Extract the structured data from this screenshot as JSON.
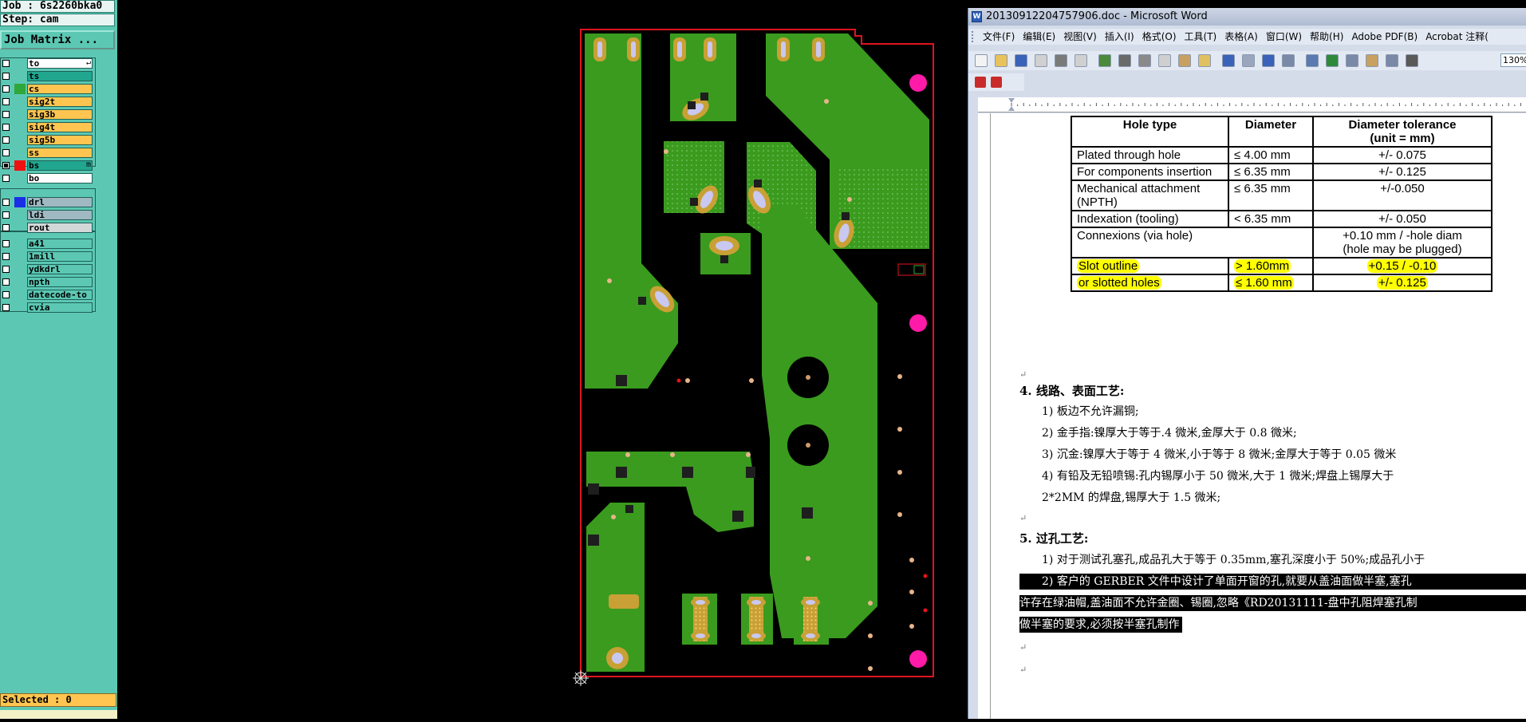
{
  "cam": {
    "job_label": "Job : 6s2260bka0",
    "step_label": "Step: cam",
    "job_matrix_button": "Job Matrix ...",
    "selected_label": "Selected : 0",
    "layers": [
      {
        "name": "to",
        "color": "#ffffff",
        "swatch": "",
        "checked": false,
        "mark": "↵"
      },
      {
        "name": "ts",
        "color": "#21a68f",
        "swatch": "",
        "checked": false
      },
      {
        "name": "cs",
        "color": "#ffc550",
        "swatch": "#2ea83a",
        "checked": false
      },
      {
        "name": "sig2t",
        "color": "#ffc550",
        "swatch": "",
        "checked": false
      },
      {
        "name": "sig3b",
        "color": "#ffc550",
        "swatch": "",
        "checked": false
      },
      {
        "name": "sig4t",
        "color": "#ffc550",
        "swatch": "",
        "checked": false
      },
      {
        "name": "sig5b",
        "color": "#ffc550",
        "swatch": "",
        "checked": false
      },
      {
        "name": "ss",
        "color": "#ffc550",
        "swatch": "",
        "checked": false
      },
      {
        "name": "bs",
        "color": "#21a68f",
        "swatch": "#ee1111",
        "checked": true,
        "mark": "m"
      },
      {
        "name": "bo",
        "color": "#ffffff",
        "swatch": "",
        "checked": false
      },
      {
        "name": "drl",
        "color": "#9fb8c2",
        "swatch": "#1a2ee8",
        "checked": false
      },
      {
        "name": "ldi",
        "color": "#9fb8c2",
        "swatch": "",
        "checked": false
      },
      {
        "name": "rout",
        "color": "#d2d8d8",
        "swatch": "",
        "checked": false
      },
      {
        "name": "a41",
        "color": "#5cc8b4",
        "swatch": "",
        "checked": false
      },
      {
        "name": "1mill",
        "color": "#5cc8b4",
        "swatch": "",
        "checked": false
      },
      {
        "name": "ydkdrl",
        "color": "#5cc8b4",
        "swatch": "",
        "checked": false
      },
      {
        "name": "npth",
        "color": "#5cc8b4",
        "swatch": "",
        "checked": false
      },
      {
        "name": "datecode-to",
        "color": "#5cc8b4",
        "swatch": "",
        "checked": false
      },
      {
        "name": "cvia",
        "color": "#5cc8b4",
        "swatch": "",
        "checked": false
      }
    ]
  },
  "pcb": {
    "colors": {
      "copper": "#3a9b1e",
      "outline": "#e0141e",
      "pad": "#c9a035",
      "hole": "#c9c8f0",
      "fiducial": "#ff1aa8",
      "background": "#000000"
    }
  },
  "word": {
    "title": "20130912204757906.doc - Microsoft Word",
    "menu": [
      "文件(F)",
      "编辑(E)",
      "视图(V)",
      "插入(I)",
      "格式(O)",
      "工具(T)",
      "表格(A)",
      "窗口(W)",
      "帮助(H)",
      "Adobe PDF(B)",
      "Acrobat 注释("
    ],
    "zoom": "130%",
    "table": {
      "headers": [
        "Hole type",
        "Diameter",
        "Diameter tolerance\n(unit = mm)"
      ],
      "rows": [
        [
          "Plated through hole",
          "≤ 4.00 mm",
          "+/- 0.075"
        ],
        [
          "For components insertion",
          "≤ 6.35 mm",
          "+/- 0.125"
        ],
        [
          "Mechanical attachment (NPTH)",
          "≤ 6.35 mm",
          "+/-0.050"
        ],
        [
          "Indexation (tooling)",
          "< 6.35 mm",
          "+/- 0.050"
        ],
        [
          "Connexions (via hole)",
          "",
          "+0.10 mm / -hole diam\n(hole may be plugged)"
        ],
        [
          "Slot outline",
          "> 1.60mm",
          "+0.15 / -0.10"
        ],
        [
          "or slotted holes",
          "≤ 1.60 mm",
          "+/- 0.125"
        ]
      ]
    },
    "section4": {
      "heading": "4.   线路、表面工艺:",
      "items": [
        "1)  板边不允许漏铜;",
        "2)  金手指:镍厚大于等于.4 微米,金厚大于 0.8 微米;",
        "3)  沉金:镍厚大于等于 4 微米,小于等于 8 微米;金厚大于等于 0.05 微米",
        "4)  有铅及无铅喷锡:孔内锡厚小于 50 微米,大于 1 微米;焊盘上锡厚大于",
        "      2*2MM 的焊盘,锡厚大于 1.5 微米;"
      ]
    },
    "section5": {
      "heading": "5.   过孔工艺:",
      "items": [
        "1)  对于测试孔塞孔,成品孔大于等于 0.35mm,塞孔深度小于 50%;成品孔小于",
        "2)  客户的 GERBER 文件中设计了单面开窗的孔,就要从盖油面做半塞,塞孔",
        "许存在绿油帽,盖油面不允许金圈、锡圈,忽略《RD20131111-盘中孔阻焊塞孔制",
        "做半塞的要求,必须按半塞孔制作"
      ]
    }
  }
}
